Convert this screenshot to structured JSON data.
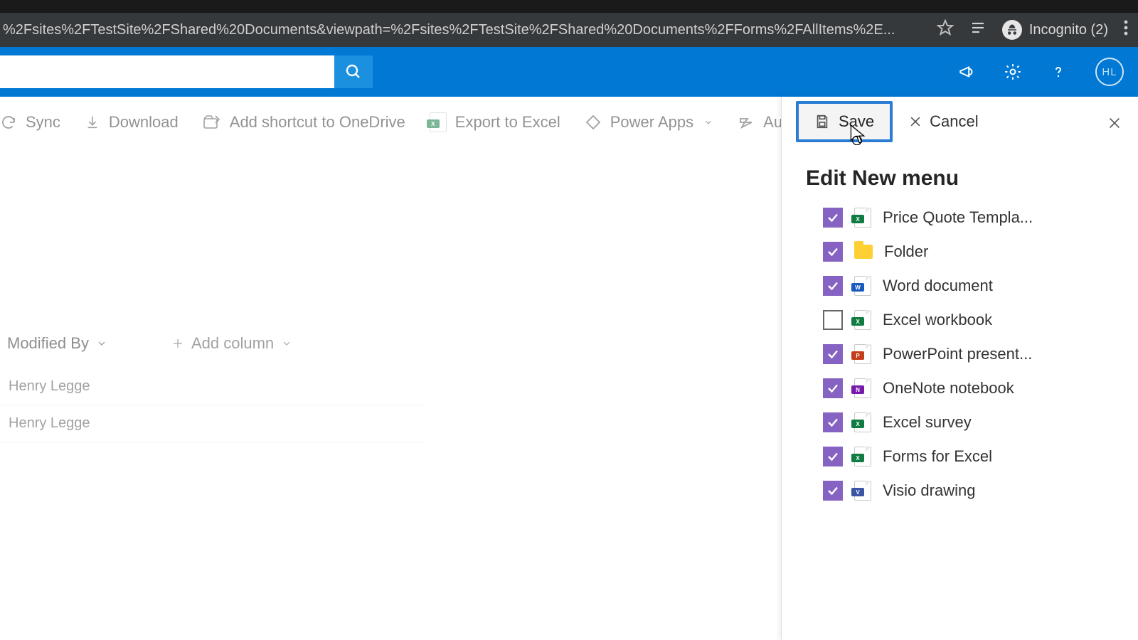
{
  "browser": {
    "url": "%2Fsites%2FTestSite%2FShared%20Documents&viewpath=%2Fsites%2FTestSite%2FShared%20Documents%2FForms%2FAllItems%2E...",
    "incognito_label": "Incognito (2)"
  },
  "suite": {
    "avatar_initials": "HL"
  },
  "commands": {
    "sync": "Sync",
    "download": "Download",
    "add_shortcut": "Add shortcut to OneDrive",
    "export_excel": "Export to Excel",
    "power_apps": "Power Apps",
    "automate": "Automate"
  },
  "columns": {
    "modified_by": "Modified By",
    "add_column": "Add column"
  },
  "rows": [
    {
      "modified_by": "Henry Legge"
    },
    {
      "modified_by": "Henry Legge"
    }
  ],
  "panel": {
    "save": "Save",
    "cancel": "Cancel",
    "title": "Edit New menu",
    "items": [
      {
        "label": "Price Quote Templa...",
        "checked": true,
        "icon": "excel"
      },
      {
        "label": "Folder",
        "checked": true,
        "icon": "folder"
      },
      {
        "label": "Word document",
        "checked": true,
        "icon": "word"
      },
      {
        "label": "Excel workbook",
        "checked": false,
        "icon": "excel"
      },
      {
        "label": "PowerPoint present...",
        "checked": true,
        "icon": "ppt"
      },
      {
        "label": "OneNote notebook",
        "checked": true,
        "icon": "onenote"
      },
      {
        "label": "Excel survey",
        "checked": true,
        "icon": "excel"
      },
      {
        "label": "Forms for Excel",
        "checked": true,
        "icon": "excel"
      },
      {
        "label": "Visio drawing",
        "checked": true,
        "icon": "visio"
      }
    ]
  }
}
